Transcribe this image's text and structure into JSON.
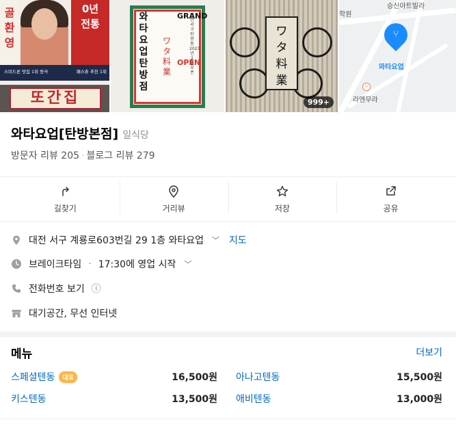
{
  "photos": {
    "p1": {
      "left_text": "골환영",
      "right_text": "0년전통",
      "band_left": "스미드론 맛집 1위 등극",
      "band_right": "패스츄 추천 1위",
      "sign": "또간집"
    },
    "p2": {
      "title_vertical": "와타요업탄방점",
      "grand": "GRAND",
      "open": "OPEN",
      "jp": "ワタ料業",
      "sub": "대전 서구 탄방동 2023년 2월 오픈"
    },
    "p3": {
      "jp": "ワタ料業",
      "count": "999+"
    },
    "map": {
      "label_top_right": "승신아트빌라",
      "label_top_left": "학원",
      "pin_label": "와타요업",
      "poi_label": "라멘무라"
    }
  },
  "place": {
    "name": "와타요업[탄방본점]",
    "category": "일식당",
    "visitor_reviews": "방문자 리뷰 205",
    "blog_reviews": "블로그 리뷰 279",
    "sep": "·"
  },
  "actions": [
    {
      "label": "길찾기",
      "icon": "directions-icon"
    },
    {
      "label": "거리뷰",
      "icon": "location-pin-icon"
    },
    {
      "label": "저장",
      "icon": "star-icon"
    },
    {
      "label": "공유",
      "icon": "share-icon"
    }
  ],
  "info": {
    "address": "대전 서구 계룡로603번길 29 1층 와타요업",
    "address_chevron": "﹀",
    "map_link": "지도",
    "hours_status": "브레이크타임",
    "hours_dot": "·",
    "hours_detail": "17:30에 영업 시작",
    "hours_chevron": "﹀",
    "phone": "전화번호 보기",
    "phone_info": "ⓘ",
    "amenities": "대기공간, 무선 인터넷"
  },
  "menu": {
    "title": "메뉴",
    "more": "더보기",
    "items": [
      {
        "name": "스페셜텐동",
        "badge": "대표",
        "price": "16,500원"
      },
      {
        "name": "아나고텐동",
        "badge": "",
        "price": "15,500원"
      },
      {
        "name": "키스텐동",
        "badge": "",
        "price": "13,500원"
      },
      {
        "name": "애비텐동",
        "badge": "",
        "price": "13,000원"
      }
    ]
  },
  "colors": {
    "link": "#0068c3",
    "badge": "#ffb546",
    "map_pin": "#1a8cff"
  }
}
